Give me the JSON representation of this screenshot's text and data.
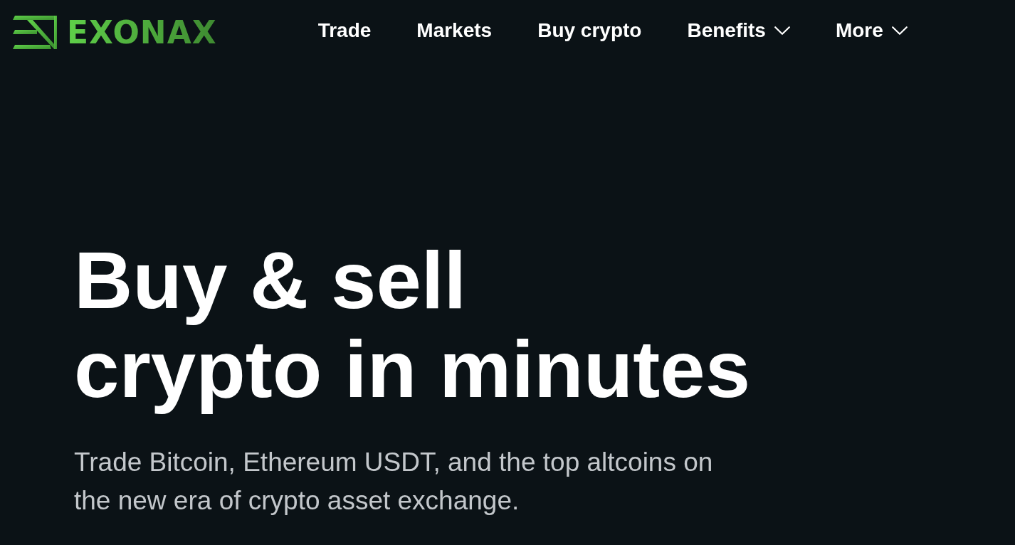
{
  "header": {
    "logo": {
      "text": "EXONAX"
    },
    "nav": [
      {
        "label": "Trade",
        "kind": "link"
      },
      {
        "label": "Markets",
        "kind": "link"
      },
      {
        "label": "Buy crypto",
        "kind": "link"
      },
      {
        "label": "Benefits",
        "kind": "dropdown"
      },
      {
        "label": "More",
        "kind": "dropdown"
      }
    ]
  },
  "hero": {
    "headline": [
      "Buy & sell",
      "crypto in minutes"
    ],
    "subtitle": [
      "Trade Bitcoin, Ethereum USDT, and the top altcoins on",
      "the new era of crypto asset exchange."
    ]
  }
}
